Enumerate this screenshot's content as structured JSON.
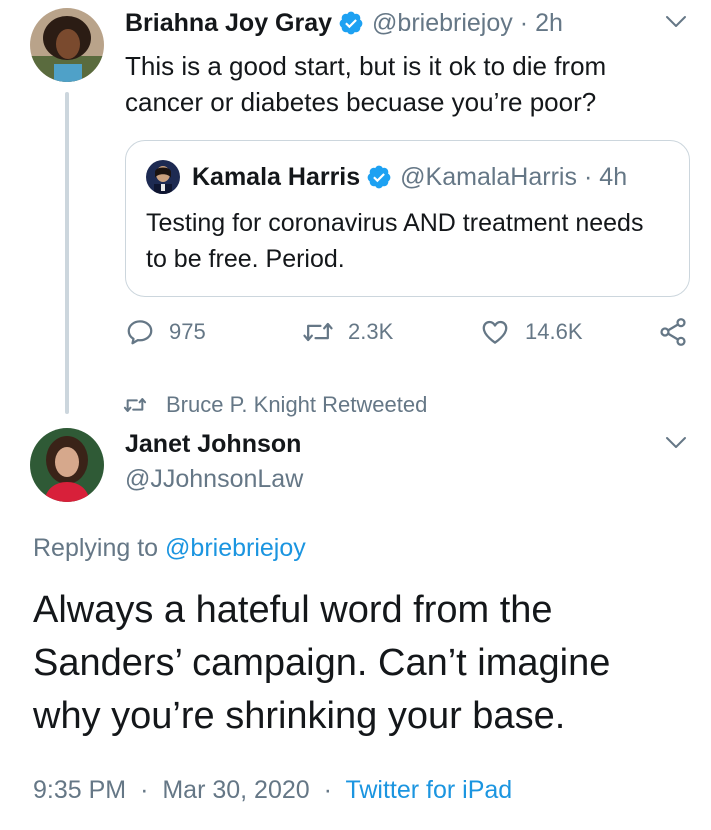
{
  "tweet1": {
    "name": "Briahna Joy Gray",
    "handle": "@briebriejoy",
    "time": "2h",
    "separator": "·",
    "text": "This is a good start, but is it ok to die from cancer or diabetes becuase you’re poor?",
    "quote": {
      "name": "Kamala Harris",
      "handle": "@KamalaHarris",
      "time": "4h",
      "text": "Testing for coronavirus AND treatment needs to be free. Period."
    },
    "actions": {
      "replies": "975",
      "retweets": "2.3K",
      "likes": "14.6K"
    }
  },
  "retweet_context": "Bruce P. Knight Retweeted",
  "tweet2": {
    "name": "Janet Johnson",
    "handle": "@JJohnsonLaw",
    "replying_prefix": "Replying to",
    "replying_to": "@briebriejoy",
    "text": "Always a hateful word from the Sanders’ campaign. Can’t imagine why you’re shrinking your base.",
    "time": "9:35 PM",
    "date": "Mar 30, 2020",
    "source": "Twitter for iPad"
  },
  "icons": {
    "verified": "verified-badge-icon",
    "caret": "chevron-down-icon",
    "reply": "reply-icon",
    "retweet": "retweet-icon",
    "like": "heart-icon",
    "share": "share-icon"
  },
  "colors": {
    "text": "#14171a",
    "muted": "#657786",
    "link": "#1b95e0",
    "verified": "#1da1f2",
    "border": "#ccd6dd"
  }
}
